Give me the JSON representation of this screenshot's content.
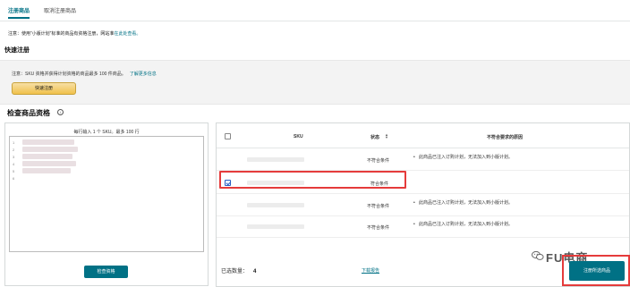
{
  "tabs": [
    {
      "label": "注册商品"
    },
    {
      "label": "取消注册商品"
    }
  ],
  "notice": {
    "text": "注意：使用“小版计划”标准的商品有资格注册，网站准",
    "link": "在此处查看。"
  },
  "quick_register": {
    "title": "快速注册",
    "description": "注意：SKU 资格并获得计划资格的商品最多 100 件商品。",
    "link": "了解更多信息",
    "button": "快速注册"
  },
  "check": {
    "title": "检查商品资格",
    "info_icon": "info-icon",
    "input_hint": "每行输入 1 个 SKU。最多 100 行",
    "line_numbers": [
      "1",
      "2",
      "3",
      "4",
      "5",
      "6"
    ],
    "check_button": "检查资格"
  },
  "table": {
    "headers": {
      "sku": "SKU",
      "status": "状态",
      "reasons": "不符合要求的原因"
    },
    "rows": [
      {
        "checked": false,
        "status": "不符合条件",
        "reasons": [
          "此商品已注入订购计划，无法加入到小版计划。"
        ]
      },
      {
        "checked": true,
        "status": "符合条件",
        "reasons": []
      },
      {
        "checked": false,
        "status": "不符合条件",
        "reasons": [
          "此商品已注入订购计划，无法加入到小版计划。"
        ]
      },
      {
        "checked": false,
        "status": "不符合条件",
        "reasons": [
          "此商品已注入订购计划，无法加入到小版计划。"
        ]
      }
    ]
  },
  "footer": {
    "count_label": "已选数量：",
    "count_value": "4",
    "download_link": "下载报告",
    "register_button": "注册所选商品"
  },
  "watermark": {
    "icon": "wechat-icon",
    "text": "FU电商"
  },
  "colors": {
    "accent": "#007185",
    "button_yellow": "#f0c14b",
    "highlight_red": "#e53b3b"
  }
}
